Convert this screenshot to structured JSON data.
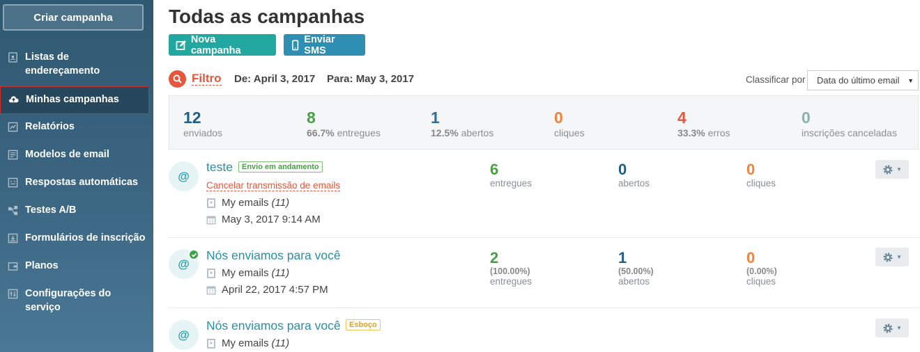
{
  "sidebar": {
    "create_label": "Criar campanha",
    "items": [
      {
        "label": "Listas de\nendereçamento",
        "icon": "address-book-icon"
      },
      {
        "label": "Minhas campanhas",
        "icon": "upload-cloud-icon"
      },
      {
        "label": "Relatórios",
        "icon": "chart-icon"
      },
      {
        "label": "Modelos de email",
        "icon": "template-icon"
      },
      {
        "label": "Respostas automáticas",
        "icon": "autoresponder-icon"
      },
      {
        "label": "Testes A/B",
        "icon": "split-test-icon"
      },
      {
        "label": "Formulários de inscrição",
        "icon": "form-icon"
      },
      {
        "label": "Planos",
        "icon": "wallet-icon"
      },
      {
        "label": "Configurações do\nserviço",
        "icon": "sliders-icon"
      }
    ]
  },
  "main": {
    "title": "Todas as campanhas",
    "new_campaign_label": "Nova campanha",
    "send_sms_label": "Enviar SMS",
    "filter_label": "Filtro",
    "date_from": "De: April 3, 2017",
    "date_to": "Para: May 3, 2017",
    "sort_label": "Classificar por",
    "sort_value": "Data do último email"
  },
  "summary": {
    "sent": {
      "num": "12",
      "label": "enviados"
    },
    "delivered": {
      "num": "8",
      "pct": "66.7%",
      "label": "entregues"
    },
    "opened": {
      "num": "1",
      "pct": "12.5%",
      "label": "abertos"
    },
    "clicks": {
      "num": "0",
      "label": "cliques"
    },
    "errors": {
      "num": "4",
      "pct": "33.3%",
      "label": "erros"
    },
    "unsubscribed": {
      "num": "0",
      "label": "inscrições canceladas"
    }
  },
  "campaigns": [
    {
      "title": "teste",
      "badge": "Envio em andamento",
      "cancel_label": "Cancelar transmissão de emails",
      "list_name": "My emails",
      "list_count": "(11)",
      "date": "May 3, 2017 9:14 AM",
      "delivered": "6",
      "delivered_label": "entregues",
      "opened": "0",
      "opened_label": "abertos",
      "clicks": "0",
      "clicks_label": "cliques"
    },
    {
      "title": "Nós enviamos para você",
      "list_name": "My emails",
      "list_count": "(11)",
      "date": "April 22, 2017 4:57 PM",
      "delivered": "2",
      "delivered_pct": "(100.00%)",
      "delivered_label": "entregues",
      "opened": "1",
      "opened_pct": "(50.00%)",
      "opened_label": "abertos",
      "clicks": "0",
      "clicks_pct": "(0.00%)",
      "clicks_label": "cliques"
    },
    {
      "title": "Nós enviamos para você",
      "badge": "Esboço",
      "list_name": "My emails",
      "list_count": "(11)"
    }
  ],
  "colors": {
    "teal": "#22a8a0",
    "blue": "#2e8fb3",
    "green": "#46a144",
    "orange": "#f0843c",
    "red": "#e4573c",
    "darkblue": "#1f5f85",
    "grayteal": "#8ab2b2"
  }
}
